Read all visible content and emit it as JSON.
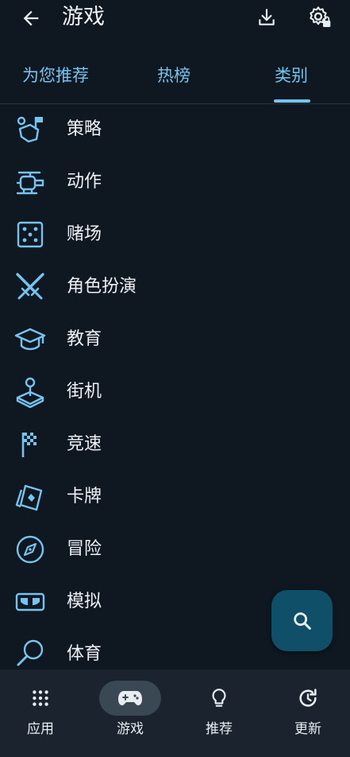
{
  "header": {
    "title": "游戏",
    "back_icon": "arrow-left-icon",
    "download_icon": "download-icon",
    "settings_icon": "settings-gear-icon"
  },
  "tabs": [
    {
      "label": "为您推荐",
      "active": false
    },
    {
      "label": "热榜",
      "active": false
    },
    {
      "label": "类别",
      "active": true
    }
  ],
  "categories": [
    {
      "label": "策略",
      "icon": "strategy-flag-icon"
    },
    {
      "label": "动作",
      "icon": "helicopter-icon"
    },
    {
      "label": "赌场",
      "icon": "dice-icon"
    },
    {
      "label": "角色扮演",
      "icon": "crossed-swords-icon"
    },
    {
      "label": "教育",
      "icon": "graduation-cap-icon"
    },
    {
      "label": "街机",
      "icon": "joystick-icon"
    },
    {
      "label": "竞速",
      "icon": "checkered-flag-icon"
    },
    {
      "label": "卡牌",
      "icon": "cards-icon"
    },
    {
      "label": "冒险",
      "icon": "compass-icon"
    },
    {
      "label": "模拟",
      "icon": "vr-headset-icon"
    },
    {
      "label": "体育",
      "icon": "racket-icon"
    }
  ],
  "fab": {
    "icon": "search-icon"
  },
  "bottom_nav": [
    {
      "label": "应用",
      "icon": "apps-grid-icon",
      "active": false
    },
    {
      "label": "游戏",
      "icon": "gamepad-icon",
      "active": true
    },
    {
      "label": "推荐",
      "icon": "lightbulb-icon",
      "active": false
    },
    {
      "label": "更新",
      "icon": "update-icon",
      "active": false
    }
  ],
  "colors": {
    "background": "#0f1720",
    "accent": "#74c4ef",
    "fab": "#0f4f68",
    "nav_background": "#1a232e"
  }
}
